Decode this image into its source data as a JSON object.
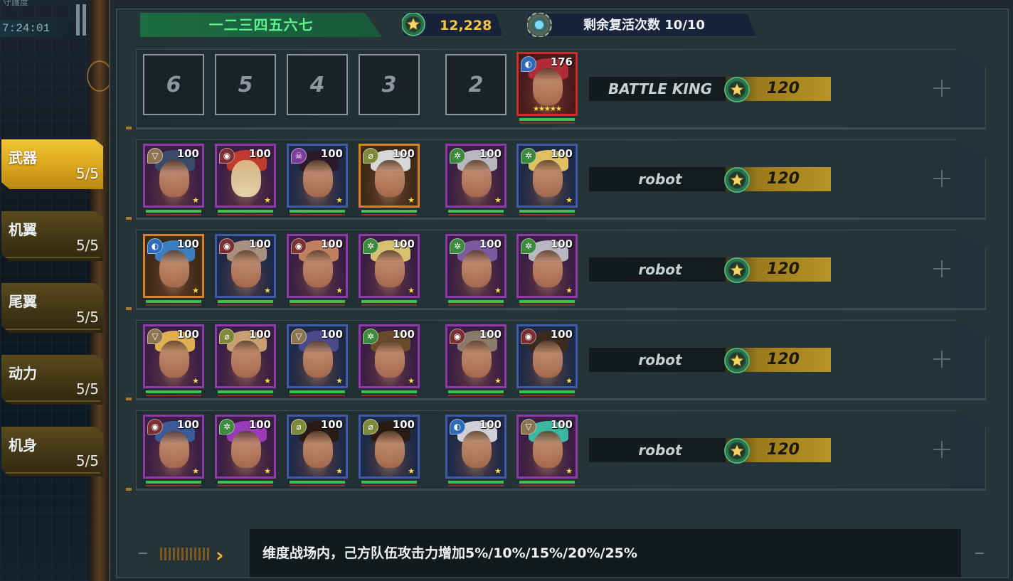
{
  "sidebar": {
    "clock_top": "守護度",
    "clock": "7:24:01",
    "categories": [
      {
        "name": "武器",
        "count": "5/5",
        "active": true
      },
      {
        "name": "机翼",
        "count": "5/5",
        "active": false
      },
      {
        "name": "尾翼",
        "count": "5/5",
        "active": false
      },
      {
        "name": "动力",
        "count": "5/5",
        "active": false
      },
      {
        "name": "机身",
        "count": "5/5",
        "active": false
      }
    ]
  },
  "header": {
    "team_name": "一二三四五六七",
    "score": "12,228",
    "revive_text": "剩余复活次数 10/10"
  },
  "rows": [
    {
      "opponent": "BATTLE KING",
      "points": "120",
      "empty_slots": [
        "6",
        "5",
        "4",
        "3",
        "2"
      ],
      "boss": {
        "level": "176",
        "badge": "blue",
        "stars": "★★★★★"
      }
    },
    {
      "opponent": "robot",
      "points": "120",
      "heroes": [
        {
          "level": "100",
          "frame": "purple",
          "badge": "tan"
        },
        {
          "level": "100",
          "frame": "purple",
          "badge": "red"
        },
        {
          "level": "100",
          "frame": "blue",
          "badge": "purple"
        },
        {
          "level": "100",
          "frame": "orange",
          "badge": "olive"
        },
        {
          "level": "100",
          "frame": "purple",
          "badge": "green"
        },
        {
          "level": "100",
          "frame": "blue",
          "badge": "green"
        }
      ]
    },
    {
      "opponent": "robot",
      "points": "120",
      "heroes": [
        {
          "level": "100",
          "frame": "orange",
          "badge": "blue"
        },
        {
          "level": "100",
          "frame": "blue",
          "badge": "red"
        },
        {
          "level": "100",
          "frame": "purple",
          "badge": "red"
        },
        {
          "level": "100",
          "frame": "purple",
          "badge": "green"
        },
        {
          "level": "100",
          "frame": "purple",
          "badge": "green"
        },
        {
          "level": "100",
          "frame": "purple",
          "badge": "green"
        }
      ]
    },
    {
      "opponent": "robot",
      "points": "120",
      "heroes": [
        {
          "level": "100",
          "frame": "purple",
          "badge": "tan"
        },
        {
          "level": "100",
          "frame": "purple",
          "badge": "olive"
        },
        {
          "level": "100",
          "frame": "blue",
          "badge": "tan"
        },
        {
          "level": "100",
          "frame": "purple",
          "badge": "green"
        },
        {
          "level": "100",
          "frame": "purple",
          "badge": "red"
        },
        {
          "level": "100",
          "frame": "blue",
          "badge": "red"
        }
      ]
    },
    {
      "opponent": "robot",
      "points": "120",
      "heroes": [
        {
          "level": "100",
          "frame": "purple",
          "badge": "red"
        },
        {
          "level": "100",
          "frame": "purple",
          "badge": "green"
        },
        {
          "level": "100",
          "frame": "blue",
          "badge": "olive"
        },
        {
          "level": "100",
          "frame": "blue",
          "badge": "olive"
        },
        {
          "level": "100",
          "frame": "blue",
          "badge": "blue"
        },
        {
          "level": "100",
          "frame": "purple",
          "badge": "tan"
        }
      ]
    }
  ],
  "footer": {
    "buff_text": "维度战场内，己方队伍攻击力增加5%/10%/15%/20%/25%"
  },
  "icons": {
    "star_medal": "star-medal-icon",
    "revive": "revive-radar-icon",
    "add": "plus-icon"
  }
}
